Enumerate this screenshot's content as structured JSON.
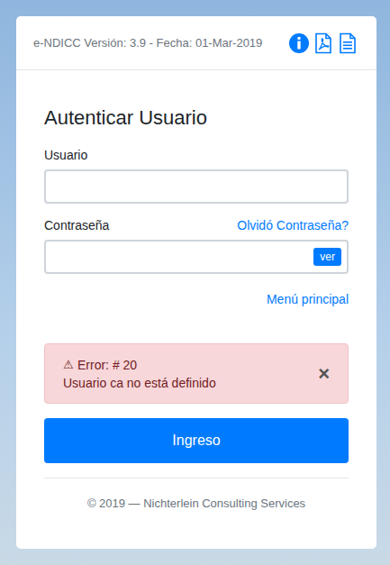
{
  "header": {
    "version_text": "e-NDICC Versión: 3.9 - Fecha: 01-Mar-2019"
  },
  "form": {
    "title": "Autenticar Usuario",
    "fields": [
      {
        "label": "Usuario",
        "kind": "text"
      },
      {
        "label": "Contraseña",
        "kind": "password",
        "link": "Olvidó Contraseña?",
        "toggle": "ver"
      }
    ],
    "menu_link": "Menú principal"
  },
  "alert": {
    "icon": "⚠",
    "code": "Error: # 20",
    "message": "Usuario ca no está definido",
    "close": "×"
  },
  "submit": "Ingreso",
  "footer": "© 2019 — Nichterlein Consulting Services"
}
